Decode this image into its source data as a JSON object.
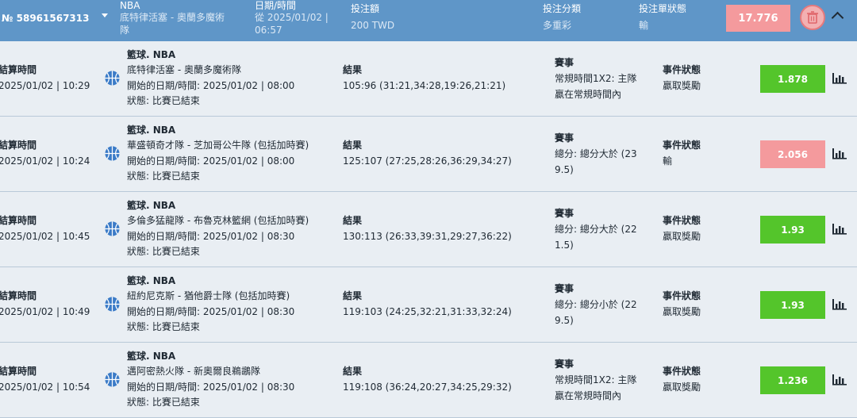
{
  "header": {
    "ticket": "№ 58961567313",
    "league_title": "NBA",
    "league_match": "底特律活塞 - 奧蘭多魔術",
    "league_match_2": "隊",
    "datetime_label": "日期/時間",
    "datetime_value": "從 2025/01/02 |",
    "datetime_value_2": "06:57",
    "stake_label": "投注額",
    "stake_value": "200 TWD",
    "bet_category_label": "投注分類",
    "bet_category_value": "多重彩",
    "bet_status_label": "投注單狀態",
    "bet_status_value": "輸",
    "total_odds": "17.776"
  },
  "colors": {
    "header_bg": "#5f96c8",
    "win": "#54c52b",
    "lose": "#f49a9d",
    "row_bg": "#e9eef3",
    "ball": "#3b7bc7"
  },
  "rows": [
    {
      "settle_label": "結算時間",
      "settle_time": "2025/01/02 | 10:29",
      "league": "籃球. NBA",
      "match": "底特律活塞 - 奧蘭多魔術隊",
      "start": "開始的日期/時間: 2025/01/02 | 08:00",
      "status": "狀態: 比賽已結束",
      "result_label": "結果",
      "result": "105:96 (31:21,34:28,19:26,21:21)",
      "market_label": "賽事",
      "market_1": "常規時間1X2: 主隊",
      "market_2": "贏在常規時間內",
      "ev_status_label": "事件狀態",
      "ev_status": "贏取獎勵",
      "odds": "1.878",
      "outcome": "win"
    },
    {
      "settle_label": "結算時間",
      "settle_time": "2025/01/02 | 10:24",
      "league": "籃球. NBA",
      "match": "華盛頓奇才隊 - 芝加哥公牛隊 (包括加時賽)",
      "start": "開始的日期/時間: 2025/01/02 | 08:00",
      "status": "狀態: 比賽已結束",
      "result_label": "結果",
      "result": "125:107 (27:25,28:26,36:29,34:27)",
      "market_label": "賽事",
      "market_1": "總分: 總分大於 (23",
      "market_2": "9.5)",
      "ev_status_label": "事件狀態",
      "ev_status": "輸",
      "odds": "2.056",
      "outcome": "lose"
    },
    {
      "settle_label": "結算時間",
      "settle_time": "2025/01/02 | 10:45",
      "league": "籃球. NBA",
      "match": "多倫多猛龍隊 - 布魯克林籃網 (包括加時賽)",
      "start": "開始的日期/時間: 2025/01/02 | 08:30",
      "status": "狀態: 比賽已結束",
      "result_label": "結果",
      "result": "130:113 (26:33,39:31,29:27,36:22)",
      "market_label": "賽事",
      "market_1": "總分: 總分大於 (22",
      "market_2": "1.5)",
      "ev_status_label": "事件狀態",
      "ev_status": "贏取獎勵",
      "odds": "1.93",
      "outcome": "win"
    },
    {
      "settle_label": "結算時間",
      "settle_time": "2025/01/02 | 10:49",
      "league": "籃球. NBA",
      "match": "紐約尼克斯 - 猶他爵士隊 (包括加時賽)",
      "start": "開始的日期/時間: 2025/01/02 | 08:30",
      "status": "狀態: 比賽已結束",
      "result_label": "結果",
      "result": "119:103 (24:25,32:21,31:33,32:24)",
      "market_label": "賽事",
      "market_1": "總分: 總分小於 (22",
      "market_2": "9.5)",
      "ev_status_label": "事件狀態",
      "ev_status": "贏取獎勵",
      "odds": "1.93",
      "outcome": "win"
    },
    {
      "settle_label": "結算時間",
      "settle_time": "2025/01/02 | 10:54",
      "league": "籃球. NBA",
      "match": "邁阿密熱火隊 - 新奧爾良鵜鶘隊",
      "start": "開始的日期/時間: 2025/01/02 | 08:30",
      "status": "狀態: 比賽已結束",
      "result_label": "結果",
      "result": "119:108 (36:24,20:27,34:25,29:32)",
      "market_label": "賽事",
      "market_1": "常規時間1X2: 主隊",
      "market_2": "贏在常規時間內",
      "ev_status_label": "事件狀態",
      "ev_status": "贏取獎勵",
      "odds": "1.236",
      "outcome": "win"
    }
  ]
}
